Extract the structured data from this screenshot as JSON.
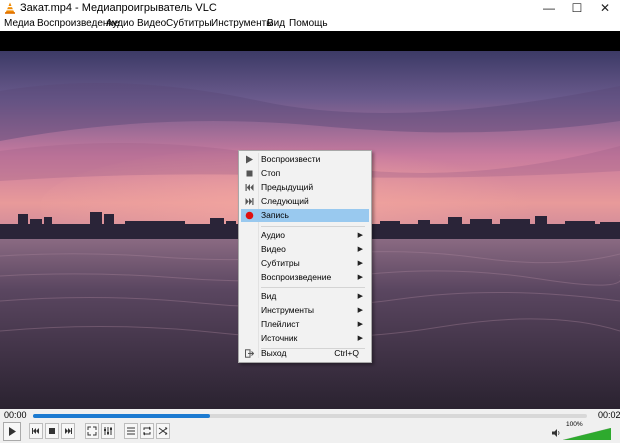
{
  "window": {
    "title": "Закат.mp4 - Медиапроигрыватель VLC",
    "minimize_label": "—",
    "maximize_label": "☐",
    "close_label": "✕"
  },
  "menubar": {
    "items": [
      "Медиа",
      "Воспроизведение",
      "Аудио",
      "Видео",
      "Субтитры",
      "Инструменты",
      "Вид",
      "Помощь"
    ]
  },
  "context_menu": {
    "items": [
      {
        "label": "Воспроизвести",
        "icon": "play-icon"
      },
      {
        "label": "Стоп",
        "icon": "stop-icon"
      },
      {
        "label": "Предыдущий",
        "icon": "previous-icon"
      },
      {
        "label": "Следующий",
        "icon": "next-icon"
      },
      {
        "label": "Запись",
        "icon": "record-icon",
        "highlighted": true
      },
      {
        "label": "Аудио",
        "submenu": true
      },
      {
        "label": "Видео",
        "submenu": true
      },
      {
        "label": "Субтитры",
        "submenu": true
      },
      {
        "label": "Воспроизведение",
        "submenu": true
      },
      {
        "label": "Вид",
        "submenu": true
      },
      {
        "label": "Инструменты",
        "submenu": true
      },
      {
        "label": "Плейлист",
        "submenu": true
      },
      {
        "label": "Источник",
        "submenu": true
      },
      {
        "label": "Выход",
        "icon": "exit-icon",
        "shortcut": "Ctrl+Q"
      }
    ],
    "submenu_arrow": "▶"
  },
  "playback": {
    "current_time": "00:00",
    "total_time": "00:02",
    "progress": 0.32
  },
  "volume": {
    "label": "100%",
    "level": 1.0
  },
  "colors": {
    "seek_fill": "#1c7bd1",
    "highlight": "#99c9ef",
    "record": "#e01010",
    "volume_fill": "#2eaa2e"
  }
}
